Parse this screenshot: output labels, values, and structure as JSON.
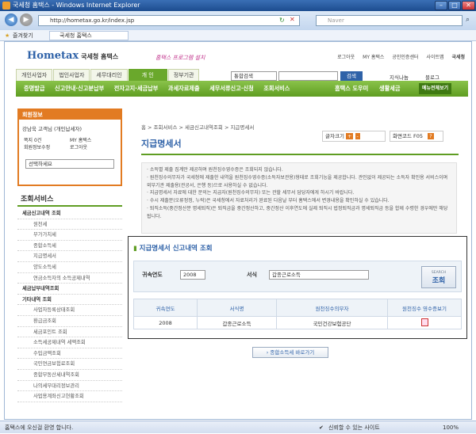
{
  "window": {
    "title": "국세청 홈택스 - Windows Internet Explorer"
  },
  "browser": {
    "url": "http://hometax.go.kr/index.jsp",
    "search_placeholder": "Naver",
    "favorites_label": "즐겨찾기",
    "tab_label": "국세청 홈택스"
  },
  "header": {
    "logo_text": "Hometax",
    "logo_sub": "국세청 홈택스",
    "slogan": "홈택스 프로그램 설치",
    "top_links": [
      "로그아웃",
      "MY 홈택스",
      "공인인증센터",
      "사이트맵",
      "국세청"
    ],
    "main_tabs": [
      "개인사업자",
      "법인사업자",
      "세무대리인",
      "개 인",
      "정부기관"
    ],
    "active_tab": "개 인",
    "search_select": "통합검색",
    "search_button": "검색",
    "right_links": [
      "지식나눔",
      "블로그"
    ],
    "nav_items": [
      "증명발급",
      "신고안내·신고분납부",
      "전자고지·세금납부",
      "과세자료제출",
      "세무서류신고·신청",
      "조회서비스"
    ],
    "nav_right": [
      "홈택스 도우미",
      "생활세금",
      "메뉴전체보기"
    ]
  },
  "login": {
    "header": "회원정보",
    "user": "강남욱 고객님 (개인납세자)",
    "items": [
      "쪽지 0건",
      "MY 홈택스",
      "회원정보수정",
      "로그아웃"
    ],
    "select": "선택하세요"
  },
  "sidebar": {
    "title": "조회서비스",
    "items": [
      {
        "label": "세금신고내역 조회",
        "group": true
      },
      {
        "label": "원천세",
        "group": false
      },
      {
        "label": "부가가치세",
        "group": false
      },
      {
        "label": "종합소득세",
        "group": false
      },
      {
        "label": "지급명세서",
        "group": false
      },
      {
        "label": "양도소득세",
        "group": false
      },
      {
        "label": "연금소득자의 소득공제내역",
        "group": false
      },
      {
        "label": "세금납부내역조회",
        "group": true
      },
      {
        "label": "기타내역 조회",
        "group": true
      },
      {
        "label": "사업자등록상태조회",
        "group": false
      },
      {
        "label": "환급금조회",
        "group": false
      },
      {
        "label": "세금포인트 조회",
        "group": false
      },
      {
        "label": "소득세공제내역 세액조회",
        "group": false
      },
      {
        "label": "수입금액조회",
        "group": false
      },
      {
        "label": "국민연금보험료조회",
        "group": false
      },
      {
        "label": "종합부동산세내역조회",
        "group": false
      },
      {
        "label": "나의세무대리정보관리",
        "group": false
      },
      {
        "label": "사업용계좌신고현황조회",
        "group": false
      }
    ]
  },
  "content": {
    "breadcrumb": "홈 > 조회서비스 > 세금신고내역조회 > 지급명세서",
    "title": "지급명세서",
    "font_size_label": "글자크기",
    "screen_code_label": "화면코드 F05",
    "notices": [
      "· 소득별 제출 집계만 제공하며 원천징수영수증은 조회되지 않습니다.",
      "· 원천징수의무자가 국세청에 제출한 내역을 원천징수영수증(소득자보관용)형태로 조회기능을 제공합니다. 관인없이 제공되는 소득자 확인용 서비스이며 외부기관 제출용(관공서, 은행 등)으로 사용하실 수 없습니다.",
      "· 지급명세서 자료에 대한 문의는 지급자(원천징수의무자) 또는 관할 세무서 담당자에게 하시기 바랍니다.",
      "· 수시 제출분(오류정정, 누락)은 국세청에서 자료처리가 완료된 다음날 부터 홈택스에서 변경내용을 확인하실 수 있습니다.",
      "· 퇴직소득(중간정산분 명세퇴직)은 퇴직금을 중간정산하고, 중간정산 이후연도에 실제 퇴직시 법정퇴직금과 명세퇴직금 등을 합께 수령한 경우에만 해당됩니다."
    ],
    "query": {
      "title": "지급명세서 신고내역 조회",
      "year_label": "귀속연도",
      "year_value": "2008",
      "type_label": "서식",
      "type_value": "갑종근로소득",
      "search_small": "SEARCH",
      "search_label": "조회",
      "columns": [
        "귀속연도",
        "서식명",
        "원천징수의무자",
        "원천징수 영수증보기"
      ],
      "rows": [
        [
          "2008",
          "갑종근로소득",
          "국민건강보험공단",
          ""
        ]
      ]
    },
    "bottom_button": "종합소득세 바로가기"
  },
  "status": {
    "left": "홈택스에 오신걸 환영 합니다.",
    "zone": "신뢰할 수 있는 사이트",
    "zoom": "100%"
  }
}
